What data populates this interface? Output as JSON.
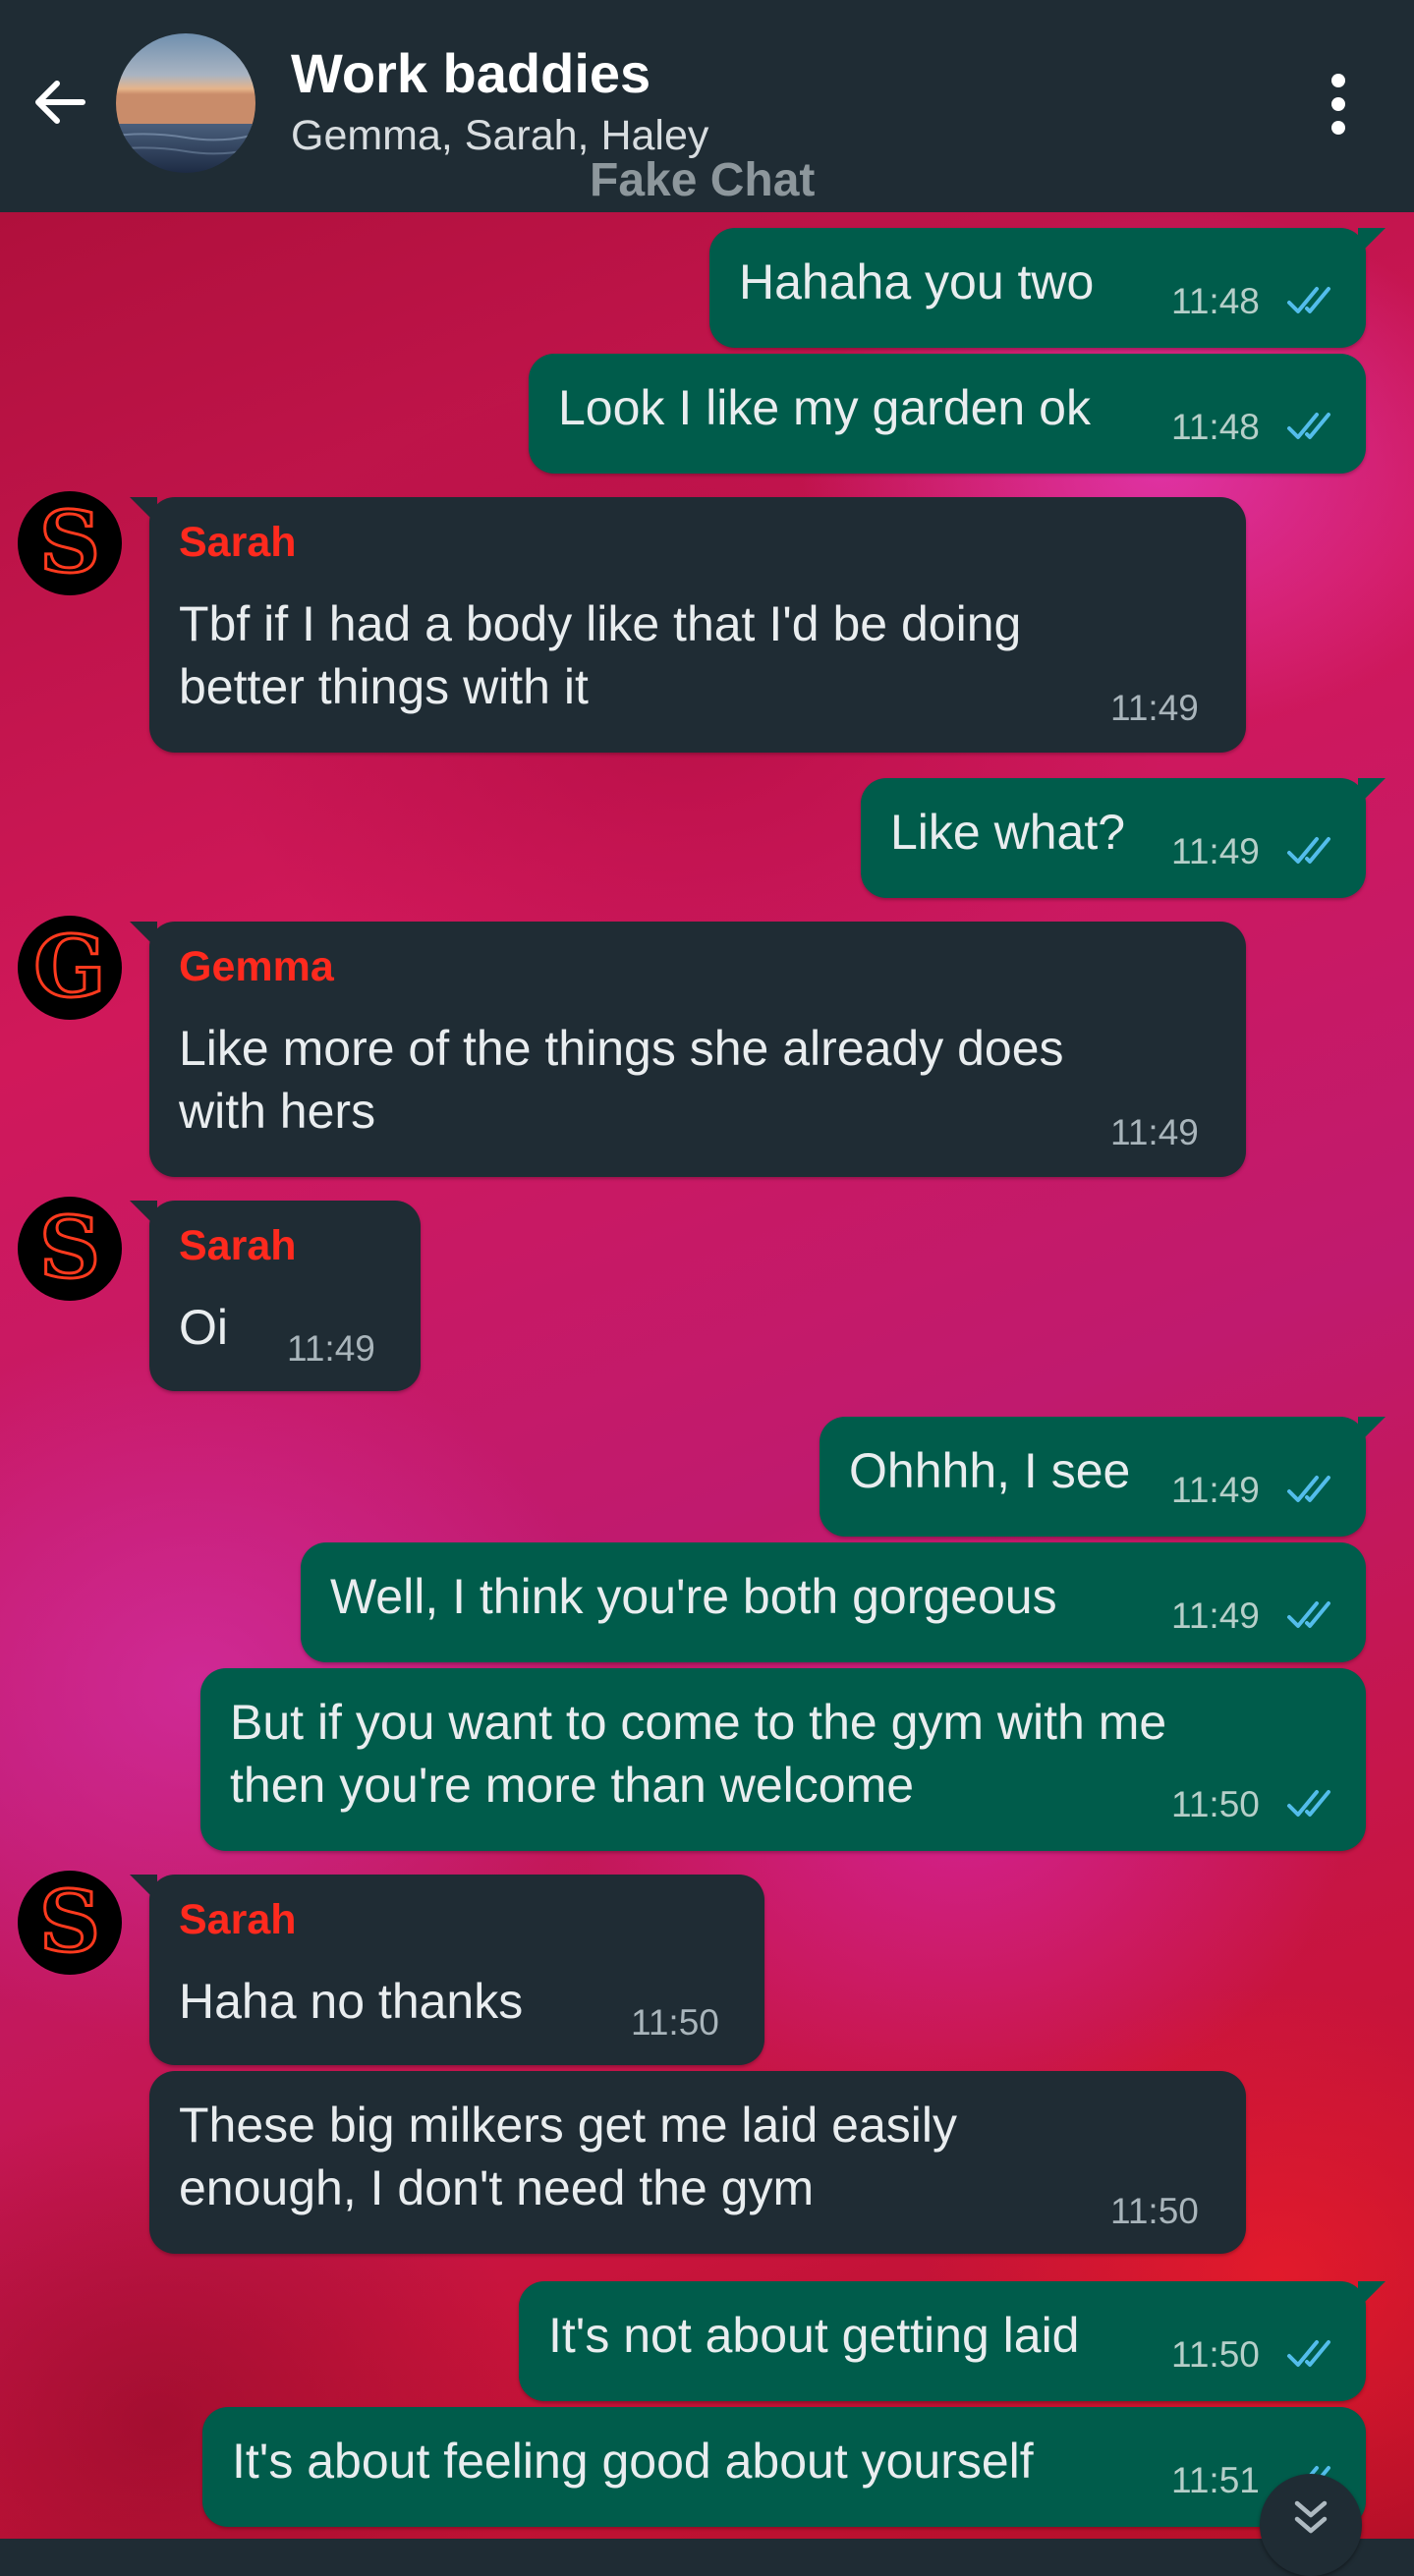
{
  "header": {
    "title": "Work baddies",
    "subtitle": "Gemma, Sarah, Haley",
    "watermark": "Fake Chat"
  },
  "icons": {
    "back": "arrow-left-icon",
    "menu": "more-vertical-icon",
    "read_receipt": "double-check-icon",
    "scroll_down": "chevron-double-down-icon"
  },
  "colors": {
    "header_bg": "#1f2c34",
    "outgoing_bubble": "#005c4b",
    "incoming_bubble": "#1f2c34",
    "sender_name": "#ff2a1e",
    "read_check": "#53bdeb"
  },
  "messages": [
    {
      "direction": "out",
      "text": "Hahaha you two",
      "time": "11:48",
      "status": "read"
    },
    {
      "direction": "out",
      "text": "Look I like my garden ok",
      "time": "11:48",
      "status": "read"
    },
    {
      "direction": "in",
      "sender": "Sarah",
      "avatar_letter": "S",
      "lines": [
        "Tbf if I had a body like that I'd be doing",
        "better things with it"
      ],
      "time": "11:49"
    },
    {
      "direction": "out",
      "text": "Like what?",
      "time": "11:49",
      "status": "read"
    },
    {
      "direction": "in",
      "sender": "Gemma",
      "avatar_letter": "G",
      "lines": [
        "Like more of the things she already does",
        "with hers"
      ],
      "time": "11:49"
    },
    {
      "direction": "in",
      "sender": "Sarah",
      "avatar_letter": "S",
      "text": "Oi",
      "time": "11:49"
    },
    {
      "direction": "out",
      "text": "Ohhhh, I see",
      "time": "11:49",
      "status": "read"
    },
    {
      "direction": "out",
      "text": "Well, I think you're both gorgeous",
      "time": "11:49",
      "status": "read"
    },
    {
      "direction": "out",
      "lines": [
        "But if you want to come to the gym with me",
        "then you're more than welcome"
      ],
      "time": "11:50",
      "status": "read"
    },
    {
      "direction": "in",
      "sender": "Sarah",
      "avatar_letter": "S",
      "text": "Haha no thanks",
      "time": "11:50"
    },
    {
      "direction": "in",
      "lines": [
        "These big milkers get me laid easily",
        "enough, I don't need the gym"
      ],
      "time": "11:50"
    },
    {
      "direction": "out",
      "text": "It's not about getting laid",
      "time": "11:50",
      "status": "read"
    },
    {
      "direction": "out",
      "text": "It's about feeling good about yourself",
      "time": "11:51",
      "status": "read"
    }
  ]
}
